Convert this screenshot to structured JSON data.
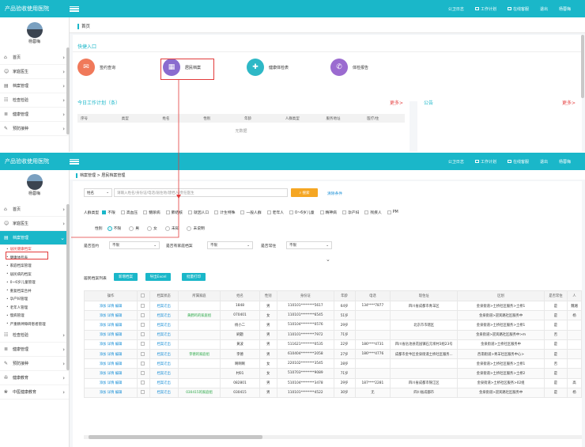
{
  "app": {
    "title": "产品验收使用医院",
    "username": "杨蓉梅"
  },
  "topnav": [
    {
      "label": "公卫日志",
      "icon": "none"
    },
    {
      "label": "工作计划",
      "icon": "square-icon"
    },
    {
      "label": "在线客服",
      "icon": "square-icon"
    },
    {
      "label": "退出",
      "icon": "none"
    },
    {
      "label": "杨蓉梅",
      "icon": "none"
    }
  ],
  "sidebar_top": {
    "items": [
      {
        "label": "首页",
        "icon": "home-icon"
      },
      {
        "label": "家庭医生",
        "icon": "user-icon"
      },
      {
        "label": "档案管理",
        "icon": "file-icon"
      },
      {
        "label": "检查检验",
        "icon": "check-icon"
      },
      {
        "label": "健康管理",
        "icon": "list-icon"
      },
      {
        "label": "预防接种",
        "icon": "syringe-icon"
      }
    ]
  },
  "sidebar_bottom": {
    "items": [
      {
        "label": "首页",
        "icon": "home-icon"
      },
      {
        "label": "家庭医生",
        "icon": "user-icon"
      },
      {
        "label": "档案管理",
        "icon": "file-icon",
        "active": true
      }
    ],
    "subitems": [
      "居民健康档案",
      "健康体检表",
      "家庭档案管理",
      "居民病的档案",
      "0~6岁儿童管理",
      "重复档案合并",
      "孕产妇管理",
      "老年人管理",
      "慢病管理",
      "严重精神障碍患者管理"
    ],
    "more": [
      {
        "label": "检查检验",
        "icon": "check-icon"
      },
      {
        "label": "健康管理",
        "icon": "list-icon"
      },
      {
        "label": "预防接种",
        "icon": "syringe-icon"
      },
      {
        "label": "健康教育",
        "icon": "book-icon"
      },
      {
        "label": "中医健康教育",
        "icon": "leaf-icon"
      }
    ]
  },
  "home": {
    "tab": "首页",
    "quick_title": "快捷入口",
    "quick": [
      {
        "label": "签约查询",
        "color": "#f0795a",
        "icon": "clipboard-icon"
      },
      {
        "label": "居民档案",
        "color": "#8a6ccf",
        "icon": "archive-icon"
      },
      {
        "label": "健康体检表",
        "color": "#2eb8c6",
        "icon": "medkit-icon"
      },
      {
        "label": "体检报告",
        "color": "#9b6bd0",
        "icon": "report-icon"
      }
    ],
    "work_title": "今日工作计划（条）",
    "more": "更多>",
    "notice_title": "公告",
    "work_cols": [
      "序号",
      "类型",
      "姓名",
      "性别",
      "年龄",
      "人群类型",
      "服务地址",
      "医疗/住"
    ],
    "empty": "无数据"
  },
  "archive": {
    "crumb": "档案管理 > 居民档案管理",
    "search": {
      "field": "姓名",
      "placeholder": "请输入姓名/身份证/电话/居住地/建档人/责任医生",
      "btn": "搜索",
      "clear": "清除条件"
    },
    "crowd_label": "人群类型",
    "crowd": [
      "不限",
      "高血压",
      "糖尿病",
      "肺结核",
      "就因人口",
      "计生特殊",
      "一般人群",
      "老年人",
      "0~6岁儿童",
      "精神病",
      "孕产妇",
      "残疾人",
      "PM"
    ],
    "gender_label": "性别",
    "gender": [
      "不限",
      "男",
      "女",
      "未知",
      "未说明"
    ],
    "f1": {
      "label": "是否签约",
      "value": "不限"
    },
    "f2": {
      "label": "是否有家庭档案",
      "value": "不限"
    },
    "f3": {
      "label": "是否常住",
      "value": "不限"
    },
    "list_label": "居民档案列表",
    "buttons": [
      "新增档案",
      "导出Excel",
      "批量打印"
    ],
    "cols": [
      "操作",
      "",
      "档案状态",
      "所属家庭",
      "姓名",
      "性别",
      "身份证",
      "年龄",
      "电话",
      "现住址",
      "区划",
      "是否常住",
      "人"
    ],
    "rows": [
      {
        "ops": "添加 详情 编辑",
        "state": "档案迁出",
        "family": "",
        "name": "1848",
        "sex": "男",
        "id": "110101********5617",
        "age": "64岁",
        "phone": "134****7877",
        "addr": "四川省成都市青羊区",
        "area": "金泉街道>土桥社区服务>土桥1",
        "res": "是",
        "x": "魏湘"
      },
      {
        "ops": "添加 详情 编辑",
        "state": "档案迁出",
        "family": "黄鹤鸣的家庭组",
        "name": "070401",
        "sex": "女",
        "id": "110101********6545",
        "age": "51岁",
        "phone": "",
        "addr": "",
        "area": "金泉街道>迎宾路社区服务中",
        "res": "是",
        "x": "杨"
      },
      {
        "ops": "添加 详情 编辑",
        "state": "档案迁出",
        "family": "",
        "name": "杨小二",
        "sex": "男",
        "id": "510104********0576",
        "age": "29岁",
        "phone": "",
        "addr": "北京市市辖区",
        "area": "金泉街道>土桥社区服务>土桥1",
        "res": "是",
        "x": ""
      },
      {
        "ops": "添加 详情 编辑",
        "state": "档案迁出",
        "family": "",
        "name": "刷题",
        "sex": "男",
        "id": "110101********7972",
        "age": "71岁",
        "phone": "",
        "addr": "",
        "area": "金泉街道>迎宾路社区服务中>m",
        "res": "否",
        "x": ""
      },
      {
        "ops": "添加 详情 编辑",
        "state": "档案迁出",
        "family": "",
        "name": "黄波",
        "sex": "男",
        "id": "511621********0535",
        "age": "22岁",
        "phone": "186****4731",
        "addr": "四川省岳池县花园镇石元坝村3组23号",
        "area": "金泉街道>土桥社区服务中",
        "res": "是",
        "x": ""
      },
      {
        "ops": "添加 详情 编辑",
        "state": "档案迁出",
        "family": "李德的家庭组",
        "name": "李德",
        "sex": "男",
        "id": "610404********2058",
        "age": "27岁",
        "phone": "186****4776",
        "addr": "成都市金牛区金泉街道土桥社区服务...",
        "area": "西南街道>青羊社区服务中心>",
        "res": "是",
        "x": ""
      },
      {
        "ops": "添加 详情 编辑",
        "state": "档案迁出",
        "family": "",
        "name": "啊啊啊",
        "sex": "女",
        "id": "220102********3545",
        "age": "28岁",
        "phone": "",
        "addr": "",
        "area": "金泉街道>土桥社区服务>土桥1",
        "res": "否",
        "x": ""
      },
      {
        "ops": "添加 详情 编辑",
        "state": "档案迁出",
        "family": "",
        "name": "村01",
        "sex": "女",
        "id": "510703********9089",
        "age": "71岁",
        "phone": "",
        "addr": "",
        "area": "金泉街道>土桥社区服务>土桥2",
        "res": "是",
        "x": ""
      },
      {
        "ops": "添加 详情 编辑",
        "state": "档案迁出",
        "family": "",
        "name": "082801",
        "sex": "男",
        "id": "510104********3478",
        "age": "29岁",
        "phone": "187****2281",
        "addr": "四川省成都市锦江区",
        "area": "金泉街道>土桥社区服务>02组",
        "res": "是",
        "x": "高"
      },
      {
        "ops": "添加 详情 编辑",
        "state": "档案迁出",
        "family": "030415的家庭组",
        "name": "030415",
        "sex": "男",
        "id": "110101********4522",
        "age": "30岁",
        "phone": "无",
        "addr": "四川省成都市",
        "area": "金泉街道>迎宾路社区服务中",
        "res": "是",
        "x": "杨"
      }
    ]
  }
}
